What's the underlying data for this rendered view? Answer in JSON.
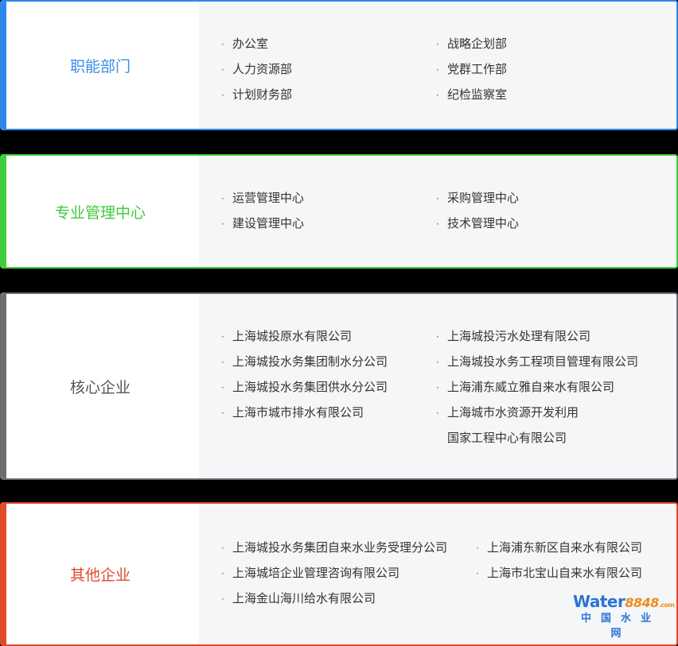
{
  "sections": [
    {
      "title": "职能部门",
      "title_color": "#3a8ee6",
      "col1": [
        "办公室",
        "人力资源部",
        "计划财务部"
      ],
      "col2": [
        "战略企划部",
        "党群工作部",
        "纪检监察室"
      ]
    },
    {
      "title": "专业管理中心",
      "title_color": "#3fc93f",
      "col1": [
        "运营管理中心",
        "建设管理中心"
      ],
      "col2": [
        "采购管理中心",
        "技术管理中心"
      ]
    },
    {
      "title": "核心企业",
      "title_color": "#555555",
      "col1": [
        "上海城投原水有限公司",
        "上海城投水务集团制水分公司",
        "上海城投水务集团供水分公司",
        "上海市城市排水有限公司"
      ],
      "col2": [
        "上海城投污水处理有限公司",
        "上海城投水务工程项目管理有限公司",
        "上海浦东威立雅自来水有限公司",
        "上海城市水资源开发利用",
        "国家工程中心有限公司"
      ]
    },
    {
      "title": "其他企业",
      "title_color": "#e04a2d",
      "col1": [
        "上海城投水务集团自来水业务受理分公司",
        "上海城培企业管理咨询有限公司",
        "上海金山海川给水有限公司"
      ],
      "col2": [
        "上海浦东新区自来水有限公司",
        "上海市北宝山自来水有限公司"
      ]
    }
  ],
  "logo": {
    "text_main": "Water",
    "text_num": "8848",
    "text_com": ".com",
    "text_cn": "中国水业网"
  }
}
